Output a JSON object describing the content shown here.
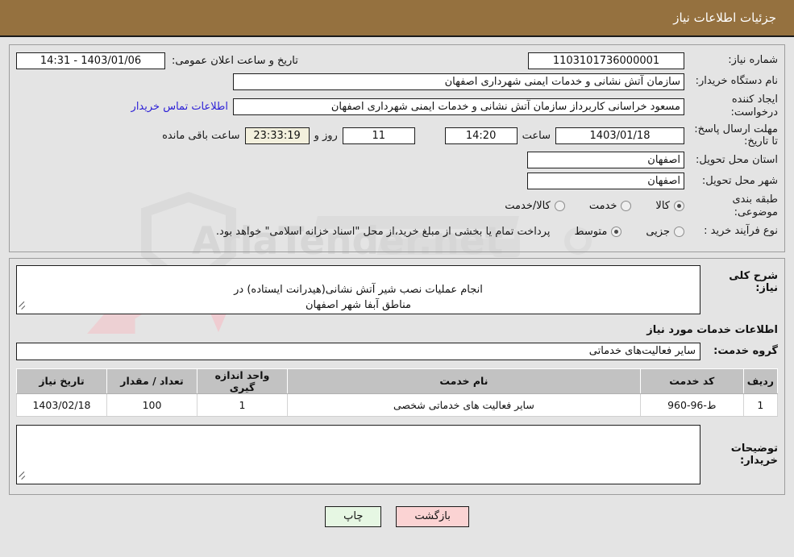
{
  "header": {
    "title": "جزئیات اطلاعات نیاز"
  },
  "form": {
    "need_number": {
      "label": "شماره نیاز:",
      "value": "1103101736000001"
    },
    "public_announce": {
      "label": "تاریخ و ساعت اعلان عمومی:",
      "value": "1403/01/06 - 14:31"
    },
    "buyer_org": {
      "label": "نام دستگاه خریدار:",
      "value": "سازمان آتش نشانی و خدمات ایمنی شهرداری اصفهان"
    },
    "creator": {
      "label": "ایجاد کننده درخواست:",
      "value": "مسعود خراسانی کاربرداز سازمان آتش نشانی و خدمات ایمنی شهرداری اصفهان"
    },
    "contact_link": "اطلاعات تماس خریدار",
    "deadline": {
      "label": "مهلت ارسال پاسخ: تا تاریخ:",
      "date": "1403/01/18",
      "time_label": "ساعت",
      "time": "14:20",
      "days": "11",
      "days_label": "روز و",
      "countdown": "23:33:19",
      "countdown_label": "ساعت باقی مانده"
    },
    "province": {
      "label": "استان محل تحویل:",
      "value": "اصفهان"
    },
    "city": {
      "label": "شهر محل تحویل:",
      "value": "اصفهان"
    },
    "category": {
      "label": "طبقه بندی موضوعی:",
      "options": [
        {
          "label": "کالا",
          "selected": true
        },
        {
          "label": "خدمت",
          "selected": false
        },
        {
          "label": "کالا/خدمت",
          "selected": false
        }
      ]
    },
    "purchase_type": {
      "label": "نوع فرآیند خرید :",
      "options": [
        {
          "label": "جزیی",
          "selected": false
        },
        {
          "label": "متوسط",
          "selected": true
        }
      ],
      "note": "پرداخت تمام یا بخشی از مبلغ خرید،از محل \"اسناد خزانه اسلامی\" خواهد بود."
    }
  },
  "description": {
    "label": "شرح کلی نیاز:",
    "value": "انجام عملیات نصب شیر آتش نشانی(هیدرانت ایستاده) در\nمناطق آبفا شهر اصفهان"
  },
  "services_section": {
    "heading": "اطلاعات خدمات مورد نیاز",
    "group": {
      "label": "گروه خدمت:",
      "value": "سایر فعالیت‌های خدماتی"
    },
    "table": {
      "columns": [
        "ردیف",
        "کد خدمت",
        "نام خدمت",
        "واحد اندازه گیری",
        "تعداد / مقدار",
        "تاریخ نیاز"
      ],
      "rows": [
        {
          "radif": "1",
          "code": "ط-96-960",
          "name": "سایر فعالیت های خدماتی شخصی",
          "unit": "1",
          "qty": "100",
          "date": "1403/02/18"
        }
      ]
    }
  },
  "buyer_notes": {
    "label": "توضیحات خریدار:",
    "value": ""
  },
  "footer": {
    "back_label": "بازگشت",
    "print_label": "چاپ"
  },
  "watermark": {
    "text": "AriaTender.net"
  }
}
